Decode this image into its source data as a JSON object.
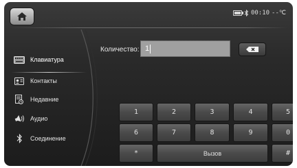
{
  "status_bar": {
    "time": "00:10",
    "temperature": "--℃",
    "icons": [
      "home-icon",
      "battery-icon",
      "bluetooth-icon"
    ]
  },
  "sidebar": {
    "items": [
      {
        "label": "Клавиатура",
        "icon": "keyboard-icon",
        "active": true
      },
      {
        "label": "Контакты",
        "icon": "contacts-card-icon",
        "active": false
      },
      {
        "label": "Недавние",
        "icon": "recent-calls-icon",
        "active": false
      },
      {
        "label": "Аудио",
        "icon": "audio-speaker-icon",
        "active": false
      },
      {
        "label": "Соединение",
        "icon": "bluetooth-icon",
        "active": false
      }
    ]
  },
  "dial": {
    "quantity_label": "Количество:",
    "quantity_value": "1",
    "delete_icon": "backspace-x-icon"
  },
  "keypad": {
    "row1": [
      "1",
      "2",
      "3",
      "4",
      "5"
    ],
    "row2": [
      "6",
      "7",
      "8",
      "9",
      "0"
    ],
    "star": "*",
    "call": "Вызов",
    "hash": "#"
  },
  "colors": {
    "background": "#2a2a2a",
    "text": "#e4e4e4",
    "input_field": "#a0a0a0",
    "key_face": "#555555"
  }
}
